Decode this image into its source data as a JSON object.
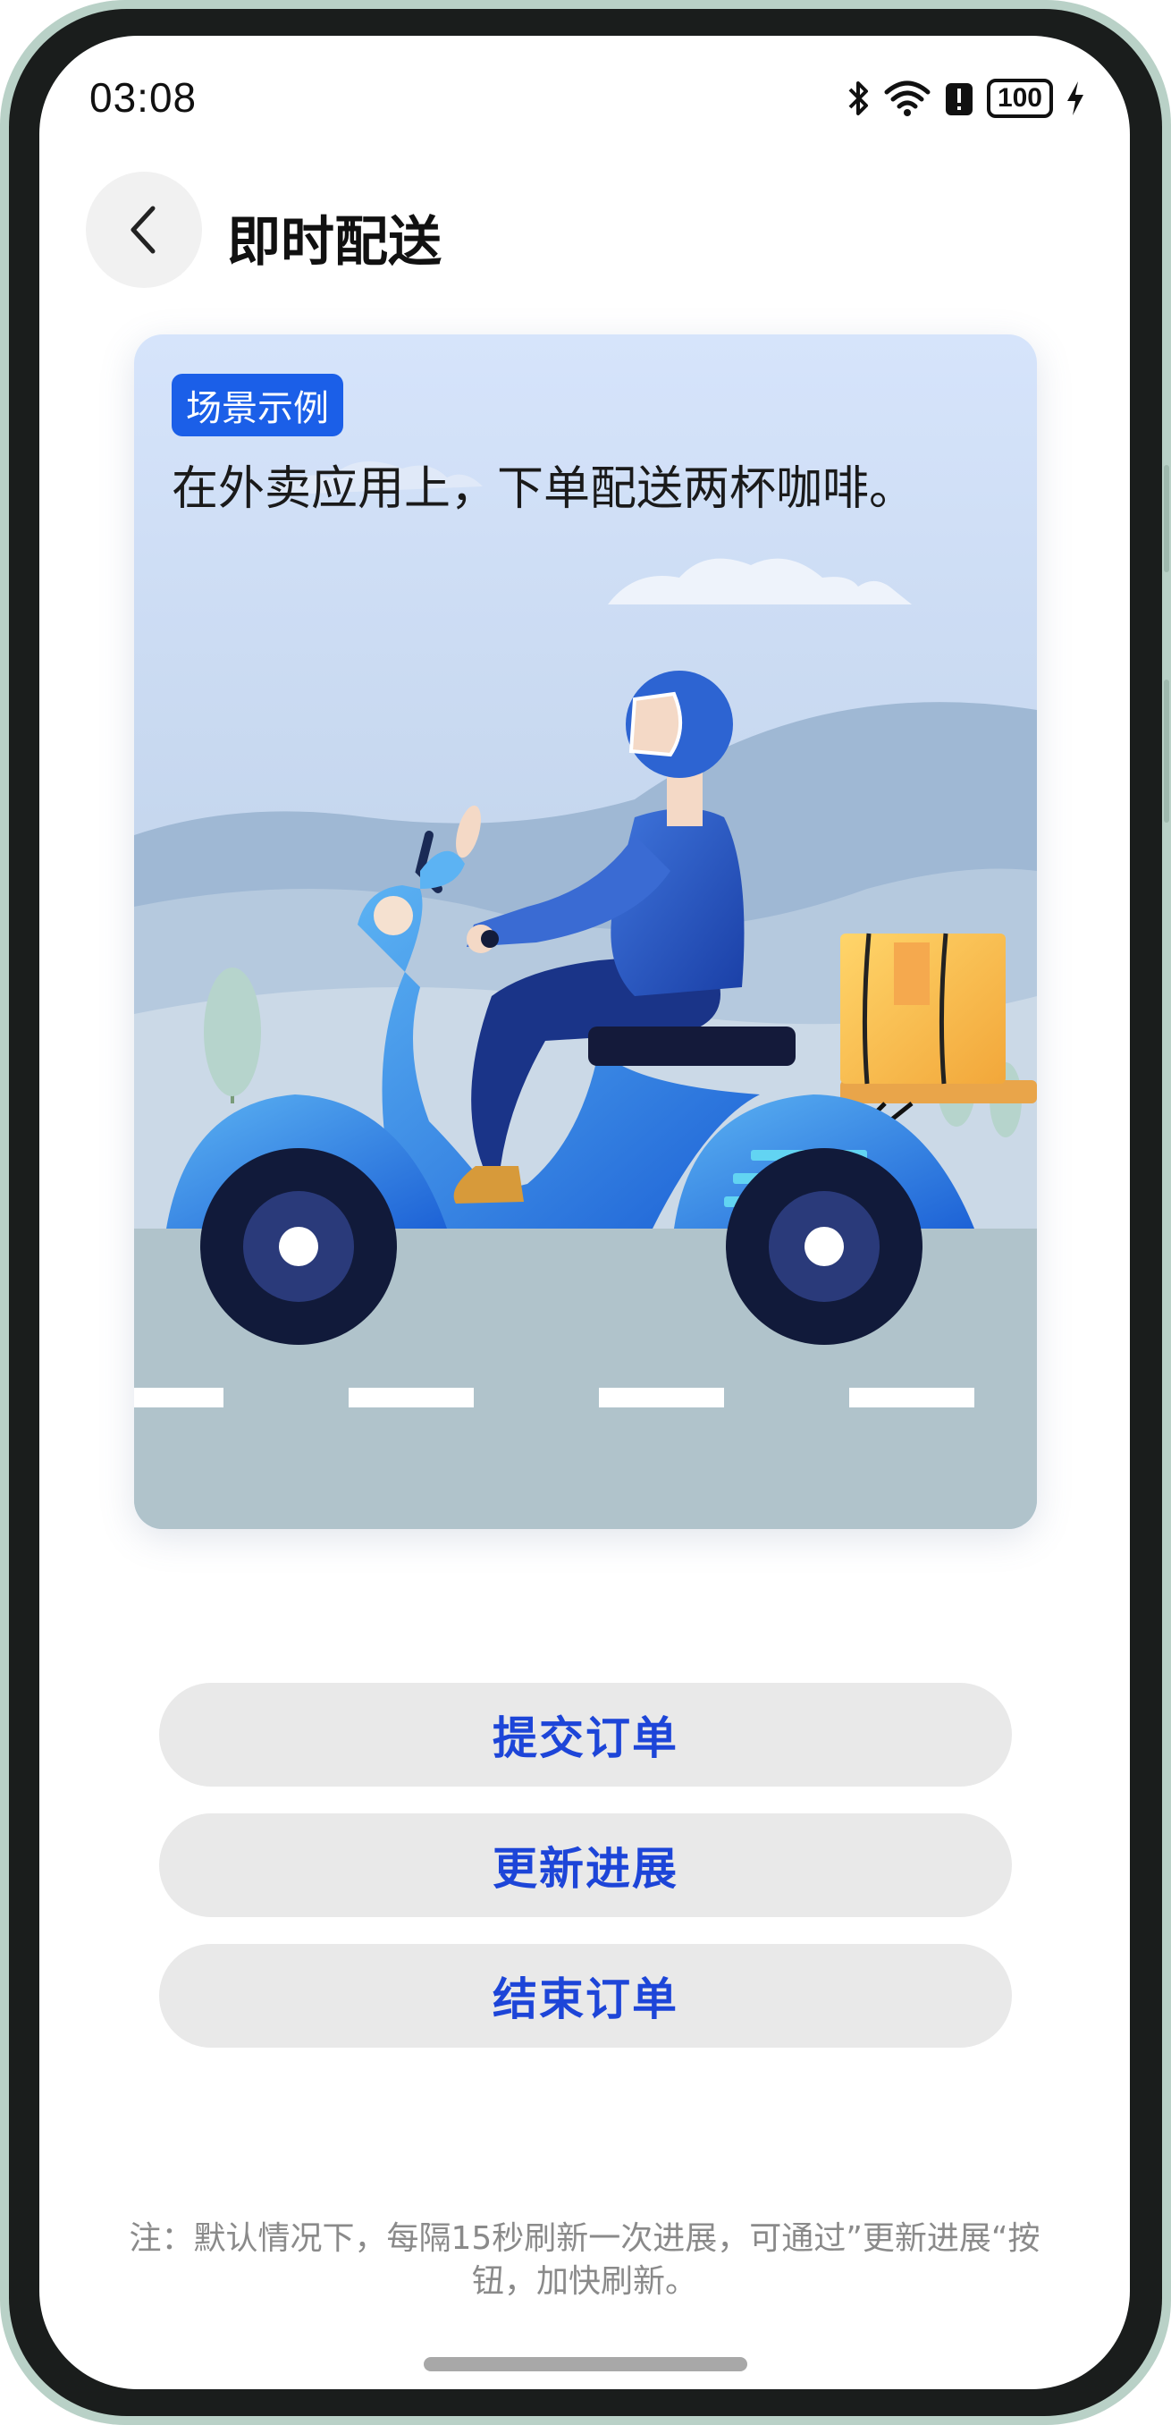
{
  "status_bar": {
    "time": "03:08",
    "battery": "100",
    "icons": [
      "bluetooth-icon",
      "wifi-icon",
      "alert-icon",
      "battery-icon",
      "charging-icon"
    ]
  },
  "header": {
    "title": "即时配送",
    "back_icon": "chevron-left-icon"
  },
  "scene": {
    "tag": "场景示例",
    "description": "在外卖应用上，下单配送两杯咖啡。",
    "illustration": "delivery-scooter-illustration"
  },
  "actions": {
    "submit_order": "提交订单",
    "update_progress": "更新进展",
    "end_order": "结束订单"
  },
  "note": {
    "line1": "注：默认情况下，每隔15秒刷新一次进展，可通过”更新进展“按",
    "line2": "钮，加快刷新。"
  },
  "colors": {
    "accent": "#1d45d8",
    "tag_bg": "#1b5fe8",
    "button_bg": "#e9e9e9"
  }
}
